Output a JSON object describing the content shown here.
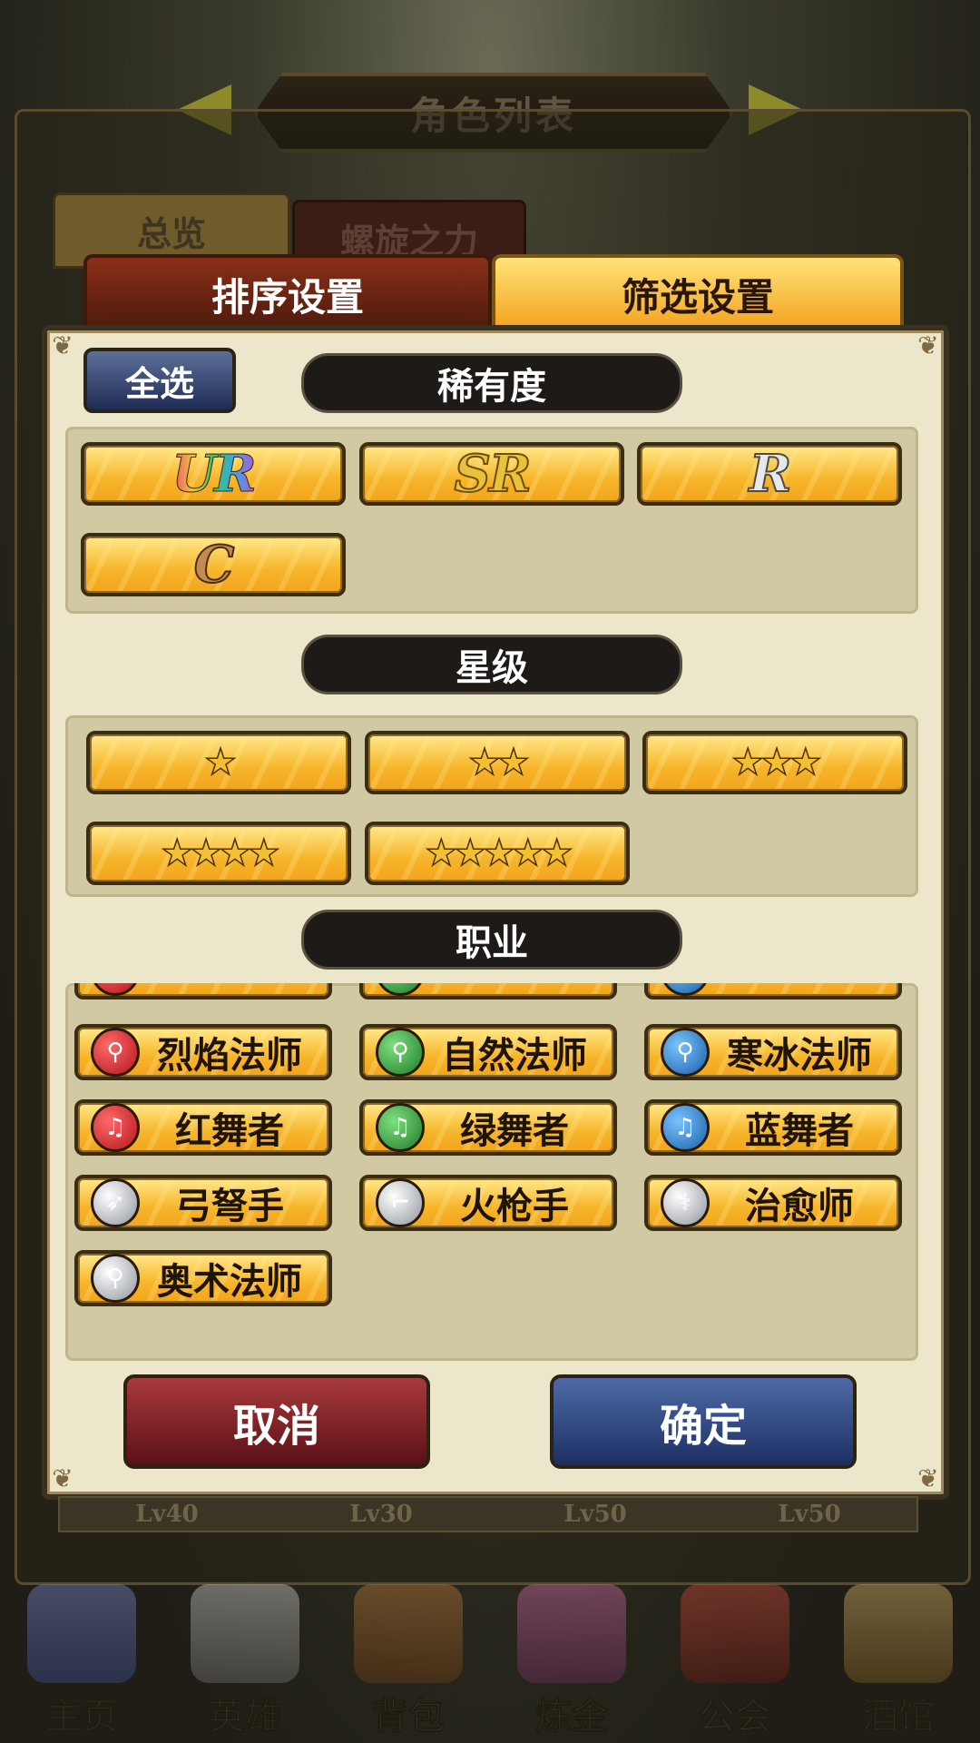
{
  "window": {
    "title": "角色列表"
  },
  "background_tabs": [
    "总览",
    "螺旋之力"
  ],
  "dialog_tabs": [
    {
      "label": "排序设置",
      "active": false
    },
    {
      "label": "筛选设置",
      "active": true
    }
  ],
  "select_all": "全选",
  "sections": {
    "rarity": {
      "title": "稀有度",
      "options": [
        "UR",
        "SR",
        "R",
        "C"
      ]
    },
    "stars": {
      "title": "星级",
      "options": [
        "★",
        "★★",
        "★★★",
        "★★★★",
        "★★★★★"
      ]
    },
    "job": {
      "title": "职业",
      "options": [
        {
          "label": "烈焰法师",
          "icon": "red-staff-icon"
        },
        {
          "label": "自然法师",
          "icon": "green-staff-icon"
        },
        {
          "label": "寒冰法师",
          "icon": "blue-staff-icon"
        },
        {
          "label": "红舞者",
          "icon": "red-lyre-icon"
        },
        {
          "label": "绿舞者",
          "icon": "green-lyre-icon"
        },
        {
          "label": "蓝舞者",
          "icon": "blue-lyre-icon"
        },
        {
          "label": "弓弩手",
          "icon": "bow-icon"
        },
        {
          "label": "火枪手",
          "icon": "musket-icon"
        },
        {
          "label": "治愈师",
          "icon": "healer-staff-icon"
        },
        {
          "label": "奥术法师",
          "icon": "arcane-staff-icon"
        }
      ]
    }
  },
  "actions": {
    "cancel": "取消",
    "confirm": "确定"
  },
  "behind_levels": [
    "Lv40",
    "Lv30",
    "Lv50",
    "Lv50"
  ],
  "bottom_nav": [
    "主页",
    "英雄",
    "背包",
    "炼金",
    "公会",
    "酒馆"
  ],
  "colors": {
    "panel_bg": "#ece6cb",
    "option_gold": "#f6b52a",
    "cancel_red": "#8a2027",
    "confirm_blue": "#2b4382"
  }
}
